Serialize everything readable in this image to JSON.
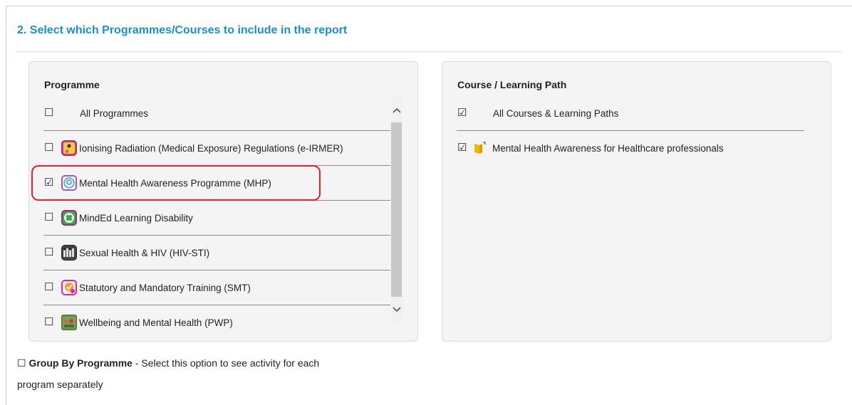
{
  "section": {
    "title": "2. Select which Programmes/Courses to include in the report"
  },
  "programme_panel": {
    "heading": "Programme",
    "items": [
      {
        "label": "All Programmes",
        "checked": false,
        "icon": ""
      },
      {
        "label": "Ionising Radiation (Medical Exposure) Regulations (e-IRMER)",
        "checked": false,
        "icon": "radiation-programme-icon"
      },
      {
        "label": "Mental Health Awareness Programme (MHP)",
        "checked": true,
        "icon": "head-programme-icon"
      },
      {
        "label": "MindEd Learning Disability",
        "checked": false,
        "icon": "minded-programme-icon"
      },
      {
        "label": "Sexual Health & HIV (HIV-STI)",
        "checked": false,
        "icon": "sexual-health-programme-icon"
      },
      {
        "label": "Statutory and Mandatory Training (SMT)",
        "checked": false,
        "icon": "smt-programme-icon"
      },
      {
        "label": "Wellbeing and Mental Health (PWP)",
        "checked": false,
        "icon": "wellbeing-programme-icon"
      }
    ]
  },
  "course_panel": {
    "heading": "Course / Learning Path",
    "items": [
      {
        "label": "All Courses & Learning Paths",
        "checked": true,
        "icon": ""
      },
      {
        "label": "Mental Health Awareness for Healthcare professionals",
        "checked": true,
        "icon": "course-book-icon"
      }
    ]
  },
  "group_by": {
    "checked": false,
    "label_bold": "Group By Programme",
    "label_rest": " - Select this option to see activity for each",
    "label_line2": "program separately"
  },
  "colors": {
    "title": "#1a8fc9",
    "highlight": "#e32025"
  }
}
